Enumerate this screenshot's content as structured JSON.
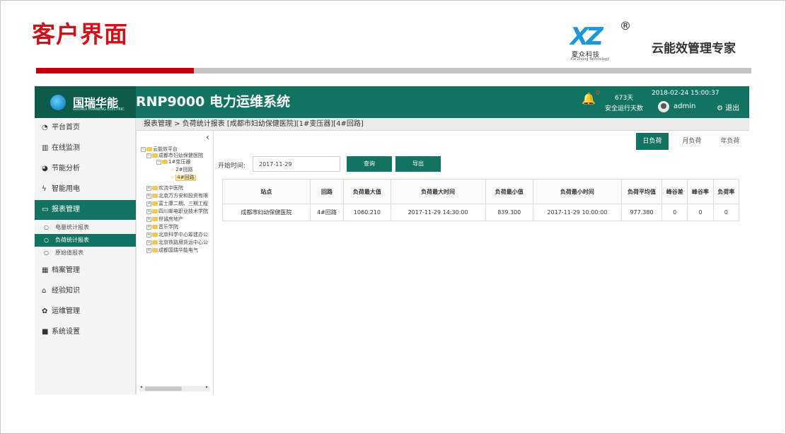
{
  "slide": {
    "title": "客户界面",
    "brand_cn": "夏众科技",
    "brand_en": "Xia Zhong Technology",
    "registered_mark": "®",
    "slogan": "云能效管理专家",
    "colors": {
      "title_red": "#d1111a",
      "divider_red": "#c0000e",
      "divider_gray": "#c3c3c3"
    }
  },
  "app": {
    "logo_text": "国瑞华能",
    "logo_sub": "GUORUI HUANENG ELECTRIC",
    "system_title": "RNP9000 电力运维系统",
    "alerts_count": "0",
    "safe_days_value": "673天",
    "safe_days_label": "安全运行天数",
    "datetime": "2018-02-24 15:00:37",
    "user": "admin",
    "logout_label": "退出",
    "colors": {
      "primary": "#137363",
      "primary_dark": "#0e5a4c",
      "bell": "#f7b500"
    }
  },
  "nav": {
    "items": [
      {
        "label": "平台首页",
        "icon": "dashboard-icon"
      },
      {
        "label": "在线监测",
        "icon": "bar-chart-icon"
      },
      {
        "label": "节能分析",
        "icon": "pie-chart-icon"
      },
      {
        "label": "智能用电",
        "icon": "bolt-icon"
      },
      {
        "label": "报表管理",
        "icon": "monitor-icon"
      },
      {
        "label": "档案管理",
        "icon": "table-icon"
      },
      {
        "label": "经验知识",
        "icon": "home-icon"
      },
      {
        "label": "运维管理",
        "icon": "gear-icon"
      },
      {
        "label": "系统设置",
        "icon": "folder-icon"
      }
    ],
    "subitems": [
      {
        "label": "电量统计报表"
      },
      {
        "label": "负荷统计报表"
      },
      {
        "label": "原始值报表"
      }
    ]
  },
  "tree": {
    "nodes": [
      {
        "label": "云能效平台"
      },
      {
        "label": "成都市妇幼保健医院"
      },
      {
        "label": "1#变压器"
      },
      {
        "label": "2#回路"
      },
      {
        "label": "4#回路"
      },
      {
        "label": "欢流中医院"
      },
      {
        "label": "北京万方安和投资有限"
      },
      {
        "label": "富士康二期、三期工程"
      },
      {
        "label": "四川邮电职业技术学院"
      },
      {
        "label": "世诚房地产"
      },
      {
        "label": "音乐学院"
      },
      {
        "label": "北京科学中心筹建办公"
      },
      {
        "label": "北京铁路局货运中心公"
      },
      {
        "label": "成都国瑞华能电气"
      }
    ]
  },
  "main": {
    "breadcrumb": "报表管理 > 负荷统计报表 [成都市妇幼保健医院][1#变压器][4#回路]",
    "tabs": [
      {
        "label": "日负荷"
      },
      {
        "label": "月负荷"
      },
      {
        "label": "年负荷"
      }
    ],
    "filter_label": "开始时间:",
    "date_value": "2017-11-29",
    "query_label": "查询",
    "export_label": "导出",
    "table": {
      "headers": [
        "站点",
        "回路",
        "负荷最大值",
        "负荷最大时间",
        "负荷最小值",
        "负荷最小时间",
        "负荷平均值",
        "峰谷差",
        "峰谷率",
        "负荷率"
      ],
      "rows": [
        [
          "成都市妇幼保健医院",
          "4#回路",
          "1060.210",
          "2017-11-29 14:30:00",
          "839.300",
          "2017-11-29 10:00:00",
          "977.380",
          "0",
          "0",
          "0"
        ]
      ]
    }
  }
}
